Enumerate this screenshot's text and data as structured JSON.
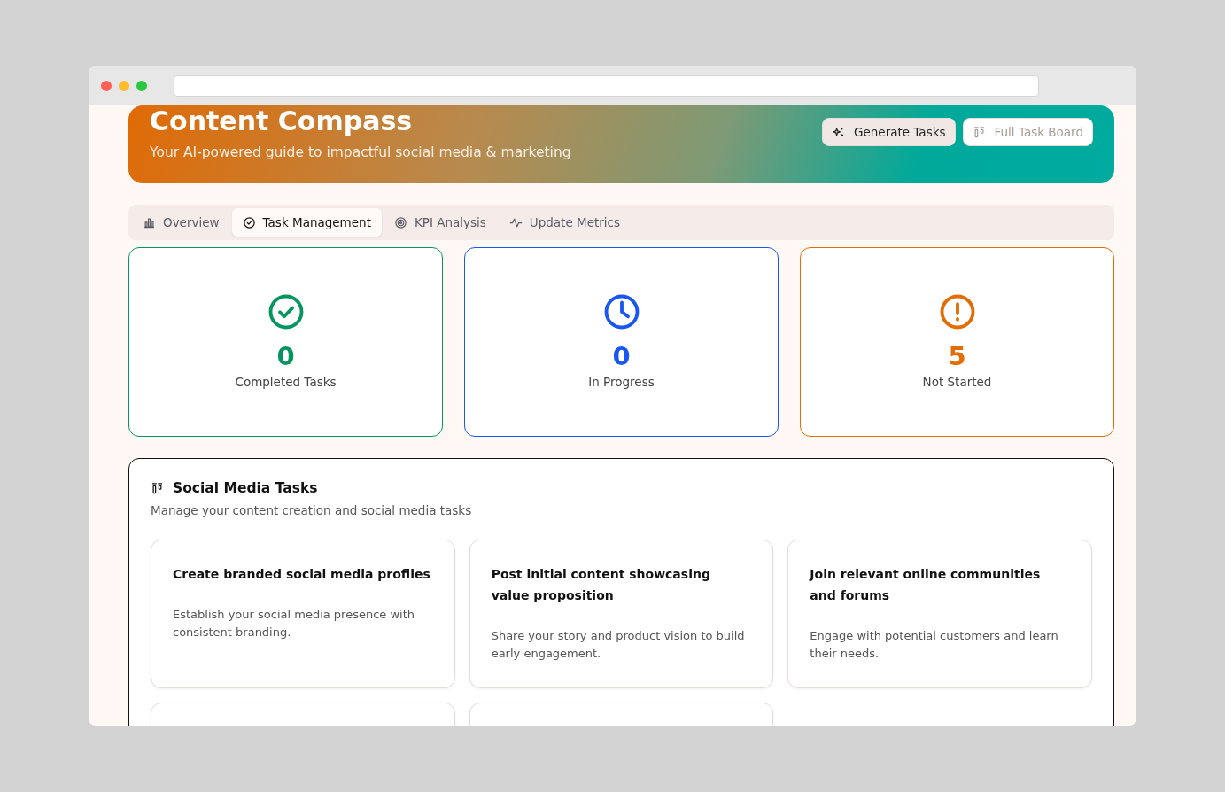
{
  "header": {
    "title": "Content Compass",
    "subtitle": "Your AI-powered guide to impactful social media & marketing",
    "buttons": [
      {
        "label": "Generate Tasks",
        "kind": "sparkle"
      },
      {
        "label": "Full Task Board",
        "kind": "board"
      }
    ]
  },
  "tabs": [
    {
      "label": "Overview",
      "kind": "chart",
      "selected": false
    },
    {
      "label": "Task Management",
      "kind": "check",
      "selected": true
    },
    {
      "label": "KPI Analysis",
      "kind": "target",
      "selected": false
    },
    {
      "label": "Update Metrics",
      "kind": "pulse",
      "selected": false
    }
  ],
  "stats": [
    {
      "value": "0",
      "label": "Completed Tasks",
      "kind": "done",
      "color": "#05965f"
    },
    {
      "value": "0",
      "label": "In Progress",
      "kind": "progress",
      "color": "#1a56f0"
    },
    {
      "value": "5",
      "label": "Not Started",
      "kind": "todo",
      "color": "#e26d04"
    }
  ],
  "tasks_panel": {
    "title": "Social Media Tasks",
    "subtitle": "Manage your content creation and social media tasks",
    "tasks": [
      {
        "kind": "card",
        "title": "Create branded social media profiles",
        "description": "Establish your social media presence with consistent branding."
      },
      {
        "kind": "card",
        "title": "Post initial content showcasing value proposition",
        "description": "Share your story and product vision to build early engagement."
      },
      {
        "kind": "card",
        "title": "Join relevant online communities and forums",
        "description": "Engage with potential customers and learn their needs."
      },
      {
        "kind": "cut"
      },
      {
        "kind": "cut"
      }
    ]
  }
}
